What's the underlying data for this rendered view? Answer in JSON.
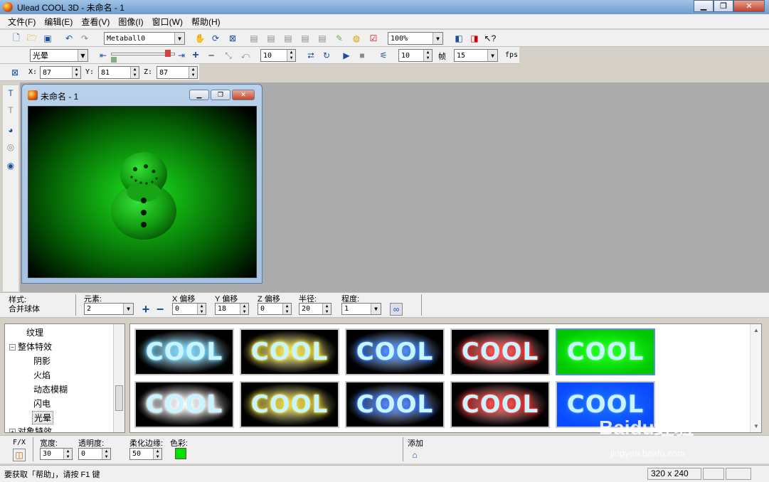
{
  "window": {
    "title": "Ulead COOL 3D - 未命名 - 1"
  },
  "menu": [
    "文件(F)",
    "编辑(E)",
    "查看(V)",
    "图像(I)",
    "窗口(W)",
    "帮助(H)"
  ],
  "toolbar1": {
    "object_combo": "Metaball0",
    "zoom_combo": "100%"
  },
  "toolbar2": {
    "effect_combo": "光晕",
    "frame_value": "10",
    "frame_count": "10",
    "frame_label": "帧",
    "fps_value": "15",
    "fps_label": "fps"
  },
  "toolbar3": {
    "x_label": "X:",
    "x_value": "87",
    "y_label": "Y:",
    "y_value": "81",
    "z_label": "Z:",
    "z_value": "87"
  },
  "document": {
    "title": "未命名 - 1"
  },
  "props": {
    "style_label": "样式:",
    "style_value": "合并球体",
    "element_label": "元素:",
    "element_value": "2",
    "xoff_label": "X 偏移",
    "xoff_value": "0",
    "yoff_label": "Y 偏移",
    "yoff_value": "18",
    "zoff_label": "Z 偏移",
    "zoff_value": "0",
    "radius_label": "半径:",
    "radius_value": "20",
    "degree_label": "程度:",
    "degree_value": "1"
  },
  "tree": {
    "items": [
      {
        "label": "纹理",
        "level": 2
      },
      {
        "label": "整体特效",
        "level": 1,
        "expanded": true
      },
      {
        "label": "阴影",
        "level": 2
      },
      {
        "label": "火焰",
        "level": 2
      },
      {
        "label": "动态模糊",
        "level": 2
      },
      {
        "label": "闪电",
        "level": 2
      },
      {
        "label": "光晕",
        "level": 2,
        "selected": true
      },
      {
        "label": "对象特效",
        "level": 1,
        "expanded": false
      }
    ]
  },
  "gallery": {
    "thumbs": [
      {
        "text": "COOL",
        "bg": "#000000",
        "glow": "#5fd0ff"
      },
      {
        "text": "COOL",
        "bg": "#000000",
        "glow": "#f5e020"
      },
      {
        "text": "COOL",
        "bg": "#000000",
        "glow": "#1a6fff"
      },
      {
        "text": "COOL",
        "bg": "#000000",
        "glow": "#ff1a1a"
      },
      {
        "text": "COOL",
        "bg": "#00c800",
        "glow": "#22ff22",
        "selected": true
      },
      {
        "text": "COOL",
        "bg": "#000000",
        "glow": "#ffffff"
      },
      {
        "text": "COOL",
        "bg": "#000000",
        "glow": "#e8d010"
      },
      {
        "text": "COOL",
        "bg": "#000000",
        "glow": "#1a60ff"
      },
      {
        "text": "COOL",
        "bg": "#000000",
        "glow": "#ff1010"
      },
      {
        "text": "COOL",
        "bg": "#0a4aff",
        "glow": "#1a6fff"
      }
    ]
  },
  "bottom": {
    "fx_label": "F/X",
    "width_label": "宽度:",
    "width_value": "30",
    "opacity_label": "透明度:",
    "opacity_value": "0",
    "soft_label": "柔化边缘:",
    "soft_value": "50",
    "color_label": "色彩:",
    "color_value": "#00e000",
    "add_label": "添加"
  },
  "status": {
    "help_text": "要获取「帮助」，请按 F1 键",
    "size_text": "320 x 240"
  },
  "watermark": {
    "brand": "Baidu",
    "brand_cn": "经验",
    "url": "jingyan.baidu.com"
  }
}
